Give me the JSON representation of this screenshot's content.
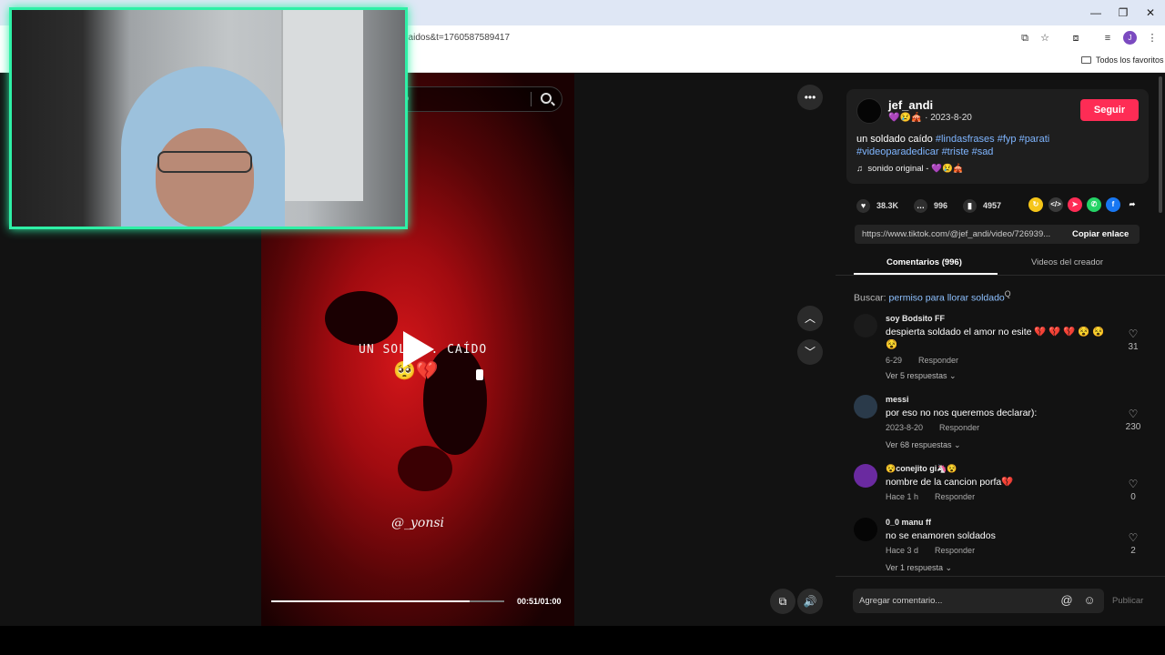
{
  "browser": {
    "url": "2caidos&t=1760587589417",
    "bookmarks_label": "Todos los favoritos",
    "profile_initial": "J"
  },
  "video": {
    "search_placeholder_fragment": "do",
    "overlay_title": "UN SOLD... CAÍDO",
    "overlay_emoji": "🥺💔",
    "watermark": "@_yonsi",
    "timecode": "00:51/01:00",
    "progress": 0.85
  },
  "post": {
    "author": "jef_andi",
    "author_badges": "💜😢🎪",
    "date": "2023-8-20",
    "description_plain": "un soldado caído",
    "hashtags_line1": "#lindasfrases #fyp #parati",
    "hashtags_line2": "#videoparadedicar #triste #sad",
    "sound": "sonido original - 💜😢🎪",
    "follow_label": "Seguir",
    "likes": "38.3K",
    "comments": "996",
    "saves": "4957",
    "link": "https://www.tiktok.com/@jef_andi/video/726939...",
    "copy_label": "Copiar enlace"
  },
  "tabs": {
    "comments": "Comentarios (996)",
    "creator_videos": "Videos del creador"
  },
  "search_suggestion": {
    "prefix": "Buscar:",
    "query": "permiso para llorar soldado"
  },
  "comments": [
    {
      "user": "soy Bodsito FF",
      "text": "despierta soldado el amor no esite 💔 💔 💔 😵 😵 😵",
      "date": "6-29",
      "reply": "Responder",
      "more": "Ver 5 respuestas",
      "likes": "31"
    },
    {
      "user": "messi",
      "text": "por eso no nos queremos declarar):",
      "date": "2023-8-20",
      "reply": "Responder",
      "more": "Ver 68 respuestas",
      "likes": "230"
    },
    {
      "user": "😵conejito gi🦄😵",
      "text": "nombre de la cancion porfa💔",
      "date": "Hace 1 h",
      "reply": "Responder",
      "more": "",
      "likes": "0"
    },
    {
      "user": "0_0 manu ff",
      "text": "no se enamoren soldados",
      "date": "Hace 3 d",
      "reply": "Responder",
      "more": "Ver 1 respuesta",
      "likes": "2"
    }
  ],
  "composer": {
    "placeholder": "Agregar comentario...",
    "publish": "Publicar"
  },
  "colors": {
    "accent": "#fe2c55",
    "webcam_border": "#2ef0a6",
    "hashtag": "#7fb5ff"
  }
}
